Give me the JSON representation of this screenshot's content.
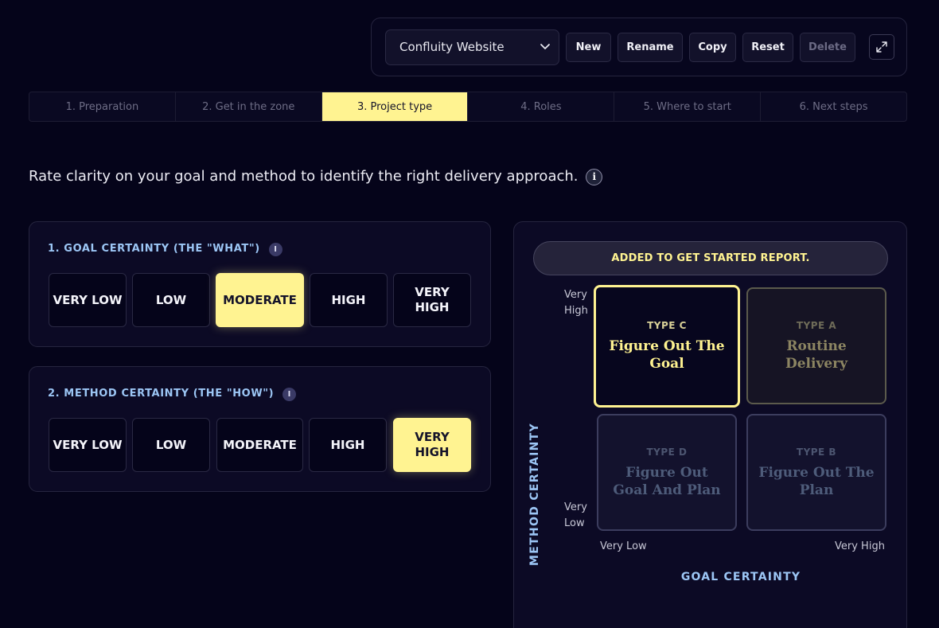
{
  "toolbar": {
    "project_select": "Confluity Website",
    "buttons": {
      "new": "New",
      "rename": "Rename",
      "copy": "Copy",
      "reset": "Reset",
      "delete": "Delete"
    }
  },
  "steps": [
    {
      "label": "1. Preparation",
      "active": false
    },
    {
      "label": "2. Get in the zone",
      "active": false
    },
    {
      "label": "3. Project type",
      "active": true
    },
    {
      "label": "4. Roles",
      "active": false
    },
    {
      "label": "5. Where to start",
      "active": false
    },
    {
      "label": "6. Next steps",
      "active": false
    }
  ],
  "intro": {
    "text": "Rate clarity on your goal and method to identify the right delivery approach.",
    "info_glyph": "i"
  },
  "goal_panel": {
    "title": "1. GOAL CERTAINTY (THE \"WHAT\")",
    "info_glyph": "I",
    "options": [
      "VERY LOW",
      "LOW",
      "MODERATE",
      "HIGH",
      "VERY HIGH"
    ],
    "selected": "MODERATE"
  },
  "method_panel": {
    "title": "2. METHOD CERTAINTY (THE \"HOW\")",
    "info_glyph": "I",
    "options": [
      "VERY LOW",
      "LOW",
      "MODERATE",
      "HIGH",
      "VERY HIGH"
    ],
    "selected": "VERY HIGH"
  },
  "matrix": {
    "report_banner": "ADDED TO GET STARTED REPORT.",
    "y_axis_label": "METHOD CERTAINTY",
    "x_axis_label": "GOAL CERTAINTY",
    "y_high": [
      "Very",
      "High"
    ],
    "y_low": [
      "Very",
      "Low"
    ],
    "x_low": "Very Low",
    "x_high": "Very High",
    "cells": {
      "c": {
        "type": "TYPE C",
        "name": "Figure Out The Goal"
      },
      "a": {
        "type": "TYPE A",
        "name": "Routine Delivery"
      },
      "d": {
        "type": "TYPE D",
        "name": "Figure Out Goal And Plan"
      },
      "b": {
        "type": "TYPE B",
        "name": "Figure Out The Plan"
      }
    },
    "active_cell": "c"
  },
  "colors": {
    "accent": "#fff391",
    "background": "#05041a",
    "panel": "#0c0a25",
    "label_blue": "#9cc6f5"
  },
  "icons": {
    "select_chevron": "chevron-down-icon",
    "expand": "expand-icon",
    "info": "info-icon"
  }
}
